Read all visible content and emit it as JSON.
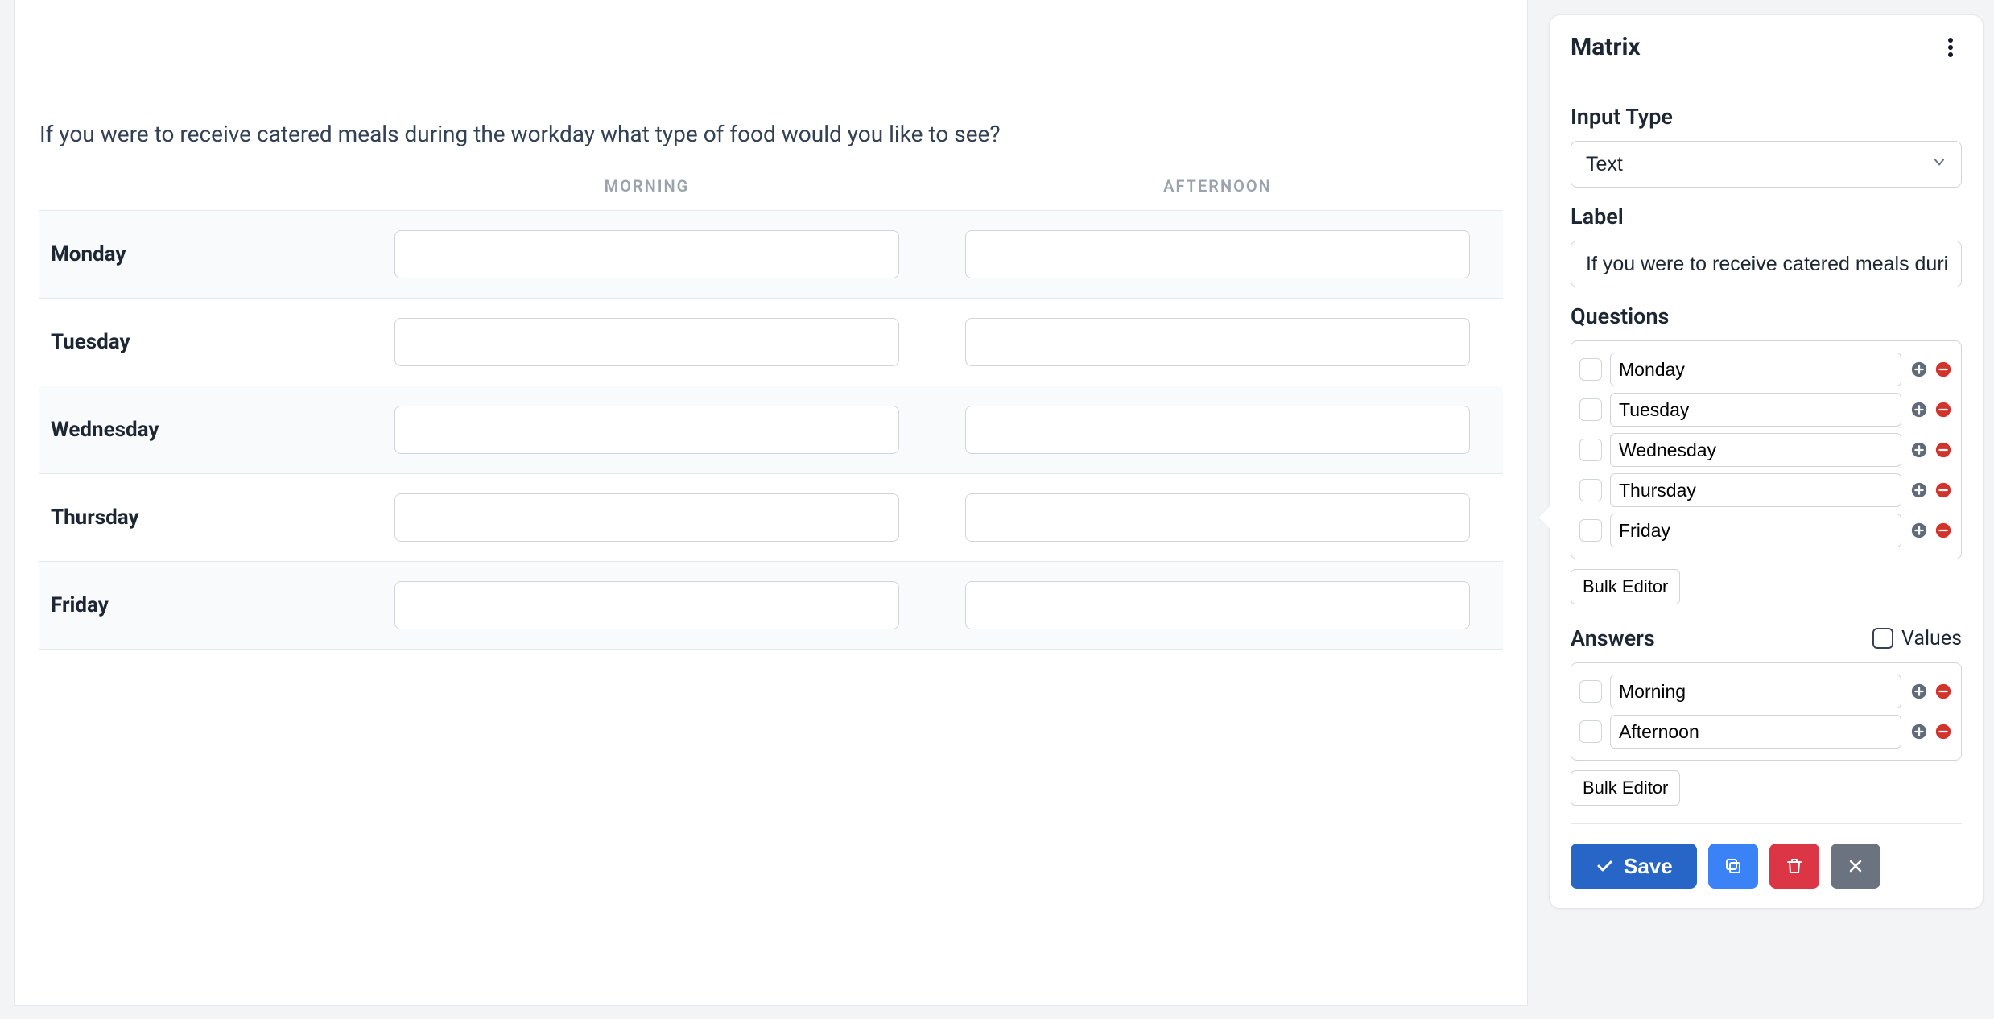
{
  "question": {
    "label_full": "If you were to receive catered meals during the workday what type of food would you like to see?",
    "columns": [
      "Morning",
      "Afternoon"
    ],
    "rows": [
      "Monday",
      "Tuesday",
      "Wednesday",
      "Thursday",
      "Friday"
    ]
  },
  "panel": {
    "title": "Matrix",
    "input_type_label": "Input Type",
    "input_type_value": "Text",
    "label_label": "Label",
    "label_value": "If you were to receive catered meals during the workday what type of food would you like to see?",
    "questions_label": "Questions",
    "questions": [
      "Monday",
      "Tuesday",
      "Wednesday",
      "Thursday",
      "Friday"
    ],
    "answers_label": "Answers",
    "values_toggle_label": "Values",
    "answers": [
      "Morning",
      "Afternoon"
    ],
    "bulk_editor_label": "Bulk Editor",
    "save_label": "Save"
  }
}
